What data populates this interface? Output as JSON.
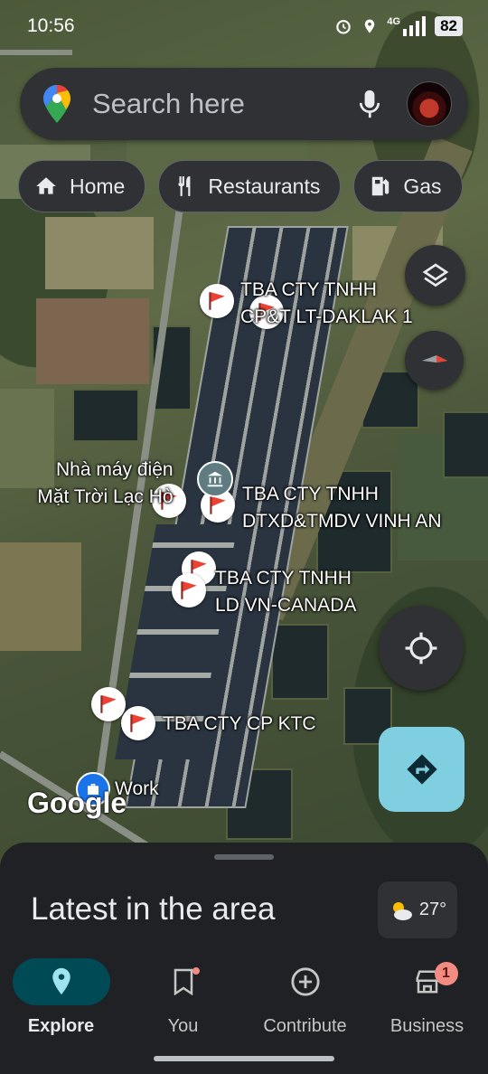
{
  "status_bar": {
    "time": "10:56",
    "network": "4G",
    "battery": "82"
  },
  "search": {
    "placeholder": "Search here"
  },
  "chips": [
    {
      "label": "Home",
      "icon": "home-icon"
    },
    {
      "label": "Restaurants",
      "icon": "restaurant-icon"
    },
    {
      "label": "Gas",
      "icon": "gas-station-icon"
    }
  ],
  "map": {
    "labels": {
      "tba1_line1": "TBA CTY TNHH",
      "tba1_line2": "CP&T LT-DAKLAK 1",
      "plant_line1": "Nhà máy điện",
      "plant_line2": "Mặt Trời Lạc Hò",
      "tba2_line1": "TBA CTY TNHH",
      "tba2_line2": "DTXD&TMDV VINH AN",
      "tba3_line1": "TBA CTY TNHH",
      "tba3_line2": "LD VN-CANADA",
      "tba4": "TBA CTY CP KTC",
      "work": "Work"
    },
    "logo": "Google"
  },
  "sheet": {
    "title": "Latest in the area",
    "temperature": "27°"
  },
  "nav": {
    "items": [
      {
        "label": "Explore"
      },
      {
        "label": "You"
      },
      {
        "label": "Contribute"
      },
      {
        "label": "Business",
        "badge": "1"
      }
    ]
  }
}
